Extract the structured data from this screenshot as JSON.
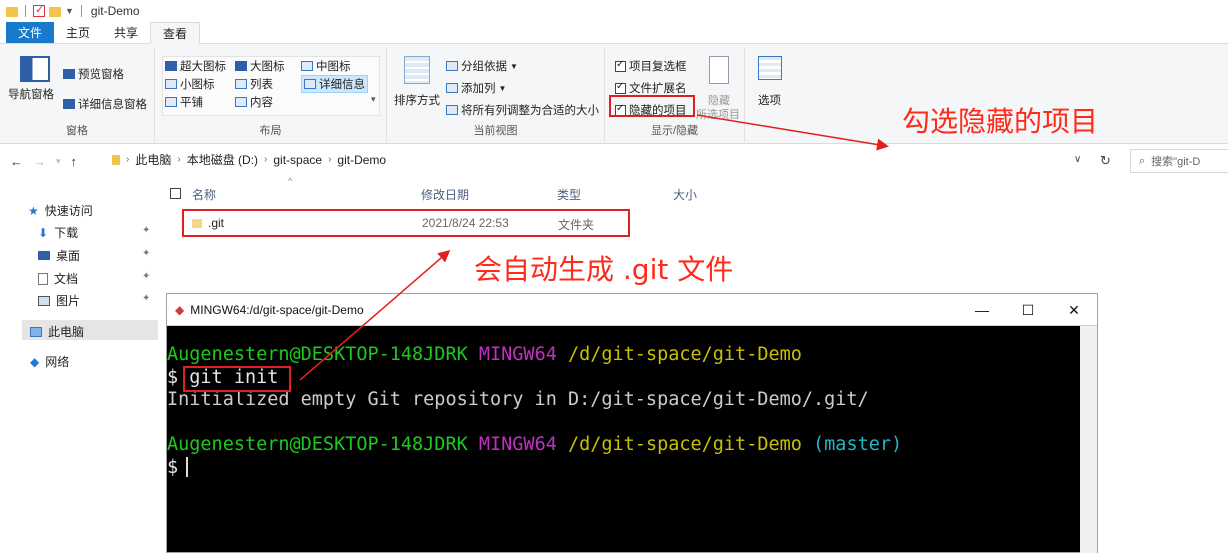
{
  "window": {
    "title": "git-Demo"
  },
  "ribbon_tabs": [
    {
      "label": "文件"
    },
    {
      "label": "主页"
    },
    {
      "label": "共享"
    },
    {
      "label": "查看"
    }
  ],
  "ribbon": {
    "pane": {
      "nav_pane": "导航窗格",
      "preview_pane": "预览窗格",
      "details_pane": "详细信息窗格",
      "label": "窗格"
    },
    "layout": {
      "extra_large": "超大图标",
      "large": "大图标",
      "medium": "中图标",
      "small": "小图标",
      "list": "列表",
      "details": "详细信息",
      "tiles": "平铺",
      "content": "内容",
      "label": "布局"
    },
    "current_view": {
      "sort": "排序方式",
      "group_by": "分组依据",
      "add_columns": "添加列",
      "fit_columns": "将所有列调整为合适的大小",
      "label": "当前视图"
    },
    "show_hide": {
      "item_checkboxes": "项目复选框",
      "file_extensions": "文件扩展名",
      "hidden_items": "隐藏的项目",
      "hide_selected_line1": "隐藏",
      "hide_selected_line2": "所选项目",
      "options": "选项",
      "label": "显示/隐藏"
    }
  },
  "annotations": {
    "check_hidden": "勾选隐藏的项目",
    "auto_generate": "会自动生成 .git 文件"
  },
  "address": {
    "crumbs": [
      "此电脑",
      "本地磁盘 (D:)",
      "git-space",
      "git-Demo"
    ],
    "search_placeholder": "搜索\"git-D"
  },
  "sidebar": {
    "quick_access": "快速访问",
    "downloads": "下载",
    "desktop": "桌面",
    "documents": "文档",
    "pictures": "图片",
    "this_pc": "此电脑",
    "network": "网络"
  },
  "file_list": {
    "columns": {
      "name": "名称",
      "modified": "修改日期",
      "type": "类型",
      "size": "大小"
    },
    "rows": [
      {
        "name": ".git",
        "modified": "2021/8/24 22:53",
        "type": "文件夹",
        "size": ""
      }
    ]
  },
  "terminal": {
    "title": "MINGW64:/d/git-space/git-Demo",
    "user_host": "Augenestern@DESKTOP-148JDRK",
    "env": "MINGW64",
    "path": "/d/git-space/git-Demo",
    "branch": "(master)",
    "prompt": "$",
    "command": "git init",
    "output": "Initialized empty Git repository in D:/git-space/git-Demo/.git/"
  },
  "colors": {
    "annotation_red": "#ff2a1a",
    "file_tab_blue": "#1979ca",
    "term_green": "#1ec91e",
    "term_magenta": "#c030c0",
    "term_yellow": "#c8c000",
    "term_cyan": "#20b8c8"
  }
}
